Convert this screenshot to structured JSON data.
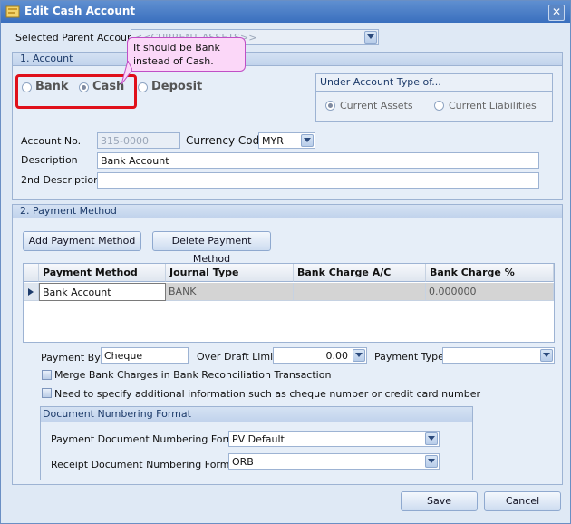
{
  "window": {
    "title": "Edit Cash Account",
    "close_glyph": "✕"
  },
  "parent": {
    "label": "Selected Parent Account",
    "value": "<<CURRENT ASSETS>>"
  },
  "annotation": {
    "text_line1": "It should be Bank",
    "text_line2": "instead of Cash."
  },
  "section_account": {
    "title": "1.   Account",
    "radio_bank": "Bank",
    "radio_cash": "Cash",
    "radio_deposit": "Deposit",
    "account_type_group": "Under Account Type of...",
    "radio_current_assets": "Current Assets",
    "radio_current_liabilities": "Current Liabilities",
    "account_no_label": "Account No.",
    "account_no_value": "315-0000",
    "currency_label": "Currency Code",
    "currency_value": "MYR",
    "description_label": "Description",
    "description_value": "Bank Account",
    "description2_label": "2nd Description",
    "description2_value": ""
  },
  "section_payment": {
    "title": "2.   Payment Method",
    "add_button": "Add Payment Method",
    "delete_button": "Delete Payment Method",
    "columns": [
      "Payment Method",
      "Journal Type",
      "Bank Charge A/C",
      "Bank Charge %"
    ],
    "rows": [
      {
        "payment_method": "Bank Account",
        "journal_type": "BANK",
        "bank_charge_ac": "",
        "bank_charge_pct": "0.000000"
      }
    ],
    "payment_by_label": "Payment By",
    "payment_by_value": "Cheque",
    "overdraft_label": "Over Draft Limit",
    "overdraft_value": "0.00",
    "payment_type_label": "Payment Type",
    "payment_type_value": "",
    "merge_label": "Merge Bank Charges in Bank Reconciliation Transaction",
    "need_info_label": "Need to specify additional information such as cheque number or credit card number",
    "doc_numbering_title": "Document Numbering Format",
    "payment_doc_label": "Payment Document Numbering Format",
    "payment_doc_value": "PV Default",
    "receipt_doc_label": "Receipt Document Numbering Format",
    "receipt_doc_value": "ORB"
  },
  "footer": {
    "save": "Save",
    "cancel": "Cancel"
  }
}
